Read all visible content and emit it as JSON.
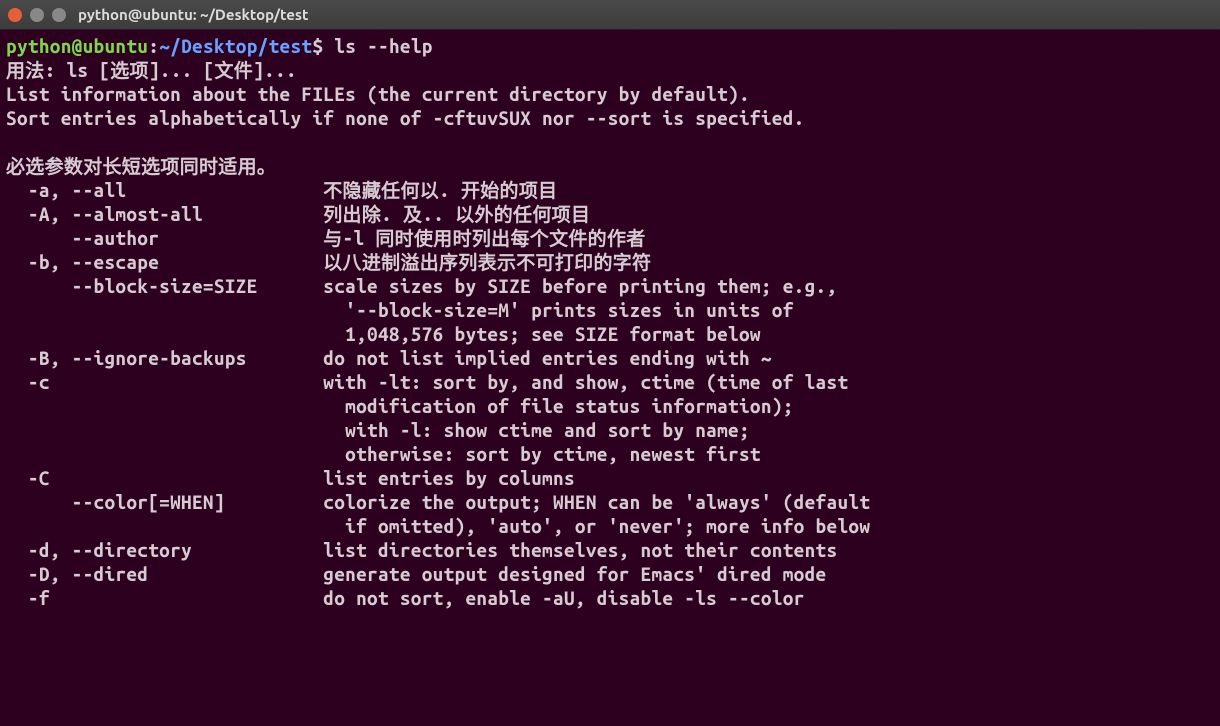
{
  "window": {
    "title": "python@ubuntu: ~/Desktop/test"
  },
  "prompt": {
    "user_host": "python@ubuntu",
    "sep1": ":",
    "path": "~/Desktop/test",
    "dollar": "$",
    "command": "ls --help"
  },
  "out": {
    "l1": "用法: ls [选项]... [文件]...",
    "l2": "List information about the FILEs (the current directory by default).",
    "l3": "Sort entries alphabetically if none of -cftuvSUX nor --sort is specified.",
    "l4": "",
    "l5": "必选参数对长短选项同时适用。",
    "l6": "  -a, --all                  不隐藏任何以. 开始的项目",
    "l7": "  -A, --almost-all           列出除. 及.. 以外的任何项目",
    "l8": "      --author               与-l 同时使用时列出每个文件的作者",
    "l9": "  -b, --escape               以八进制溢出序列表示不可打印的字符",
    "l10": "      --block-size=SIZE      scale sizes by SIZE before printing them; e.g.,",
    "l11": "                               '--block-size=M' prints sizes in units of",
    "l12": "                               1,048,576 bytes; see SIZE format below",
    "l13": "  -B, --ignore-backups       do not list implied entries ending with ~",
    "l14": "  -c                         with -lt: sort by, and show, ctime (time of last",
    "l15": "                               modification of file status information);",
    "l16": "                               with -l: show ctime and sort by name;",
    "l17": "                               otherwise: sort by ctime, newest first",
    "l18": "  -C                         list entries by columns",
    "l19": "      --color[=WHEN]         colorize the output; WHEN can be 'always' (default",
    "l20": "                               if omitted), 'auto', or 'never'; more info below",
    "l21": "  -d, --directory            list directories themselves, not their contents",
    "l22": "  -D, --dired                generate output designed for Emacs' dired mode",
    "l23": "  -f                         do not sort, enable -aU, disable -ls --color"
  }
}
